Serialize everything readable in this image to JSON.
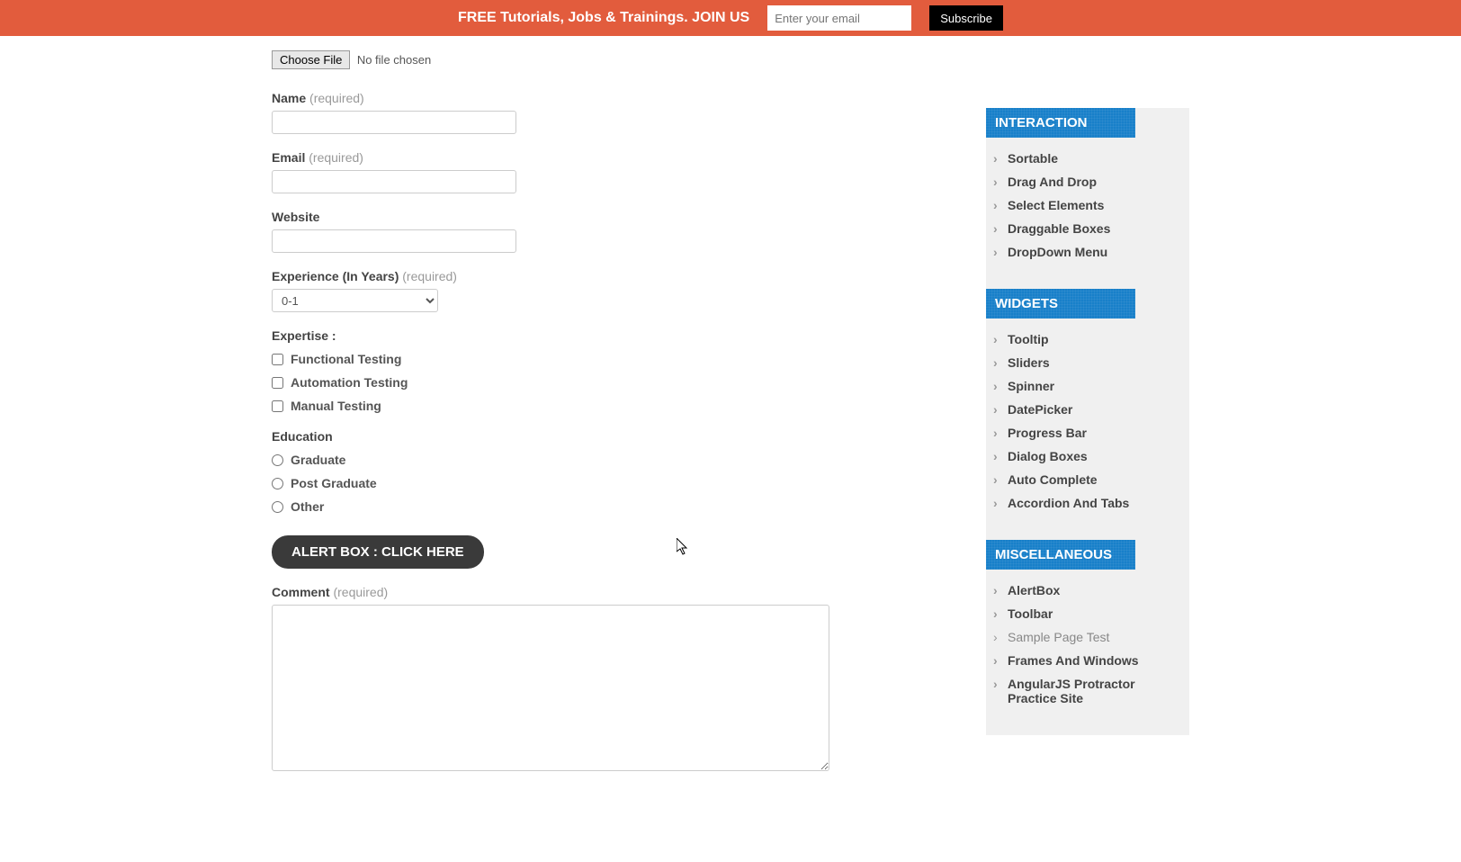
{
  "banner": {
    "text": "FREE Tutorials, Jobs & Trainings. JOIN US",
    "email_placeholder": "Enter your email",
    "subscribe_label": "Subscribe"
  },
  "form": {
    "choose_file_label": "Choose File",
    "no_file_text": "No file chosen",
    "name_label": "Name",
    "email_label": "Email",
    "website_label": "Website",
    "experience_label": "Experience (In Years)",
    "experience_value": "0-1",
    "expertise_label": "Expertise :",
    "expertise_options": {
      "functional": "Functional Testing",
      "automation": "Automation Testing",
      "manual": "Manual Testing"
    },
    "education_label": "Education",
    "education_options": {
      "graduate": "Graduate",
      "postgraduate": "Post Graduate",
      "other": "Other"
    },
    "alert_button": "ALERT BOX : CLICK HERE",
    "comment_label": "Comment",
    "required_text": "(required)"
  },
  "sidebar": {
    "interaction": {
      "title": "INTERACTION",
      "items": [
        "Sortable",
        "Drag And Drop",
        "Select Elements",
        "Draggable Boxes",
        "DropDown Menu"
      ]
    },
    "widgets": {
      "title": "WIDGETS",
      "items": [
        "Tooltip",
        "Sliders",
        "Spinner",
        "DatePicker",
        "Progress Bar",
        "Dialog Boxes",
        "Auto Complete",
        "Accordion And Tabs"
      ]
    },
    "misc": {
      "title": "MISCELLANEOUS",
      "items": [
        "AlertBox",
        "Toolbar",
        "Sample Page Test",
        "Frames And Windows",
        "AngularJS Protractor Practice Site"
      ]
    }
  }
}
